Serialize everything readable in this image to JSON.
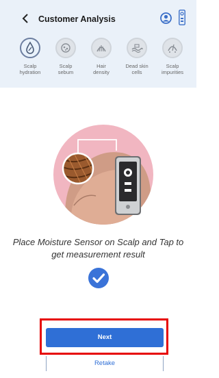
{
  "header": {
    "title": "Customer Analysis"
  },
  "tabs": [
    {
      "line1": "Scalp",
      "line2": "hydration",
      "active": true,
      "icon": "hydration-icon"
    },
    {
      "line1": "Scalp",
      "line2": "sebum",
      "active": false,
      "icon": "sebum-icon"
    },
    {
      "line1": "Hair",
      "line2": "density",
      "active": false,
      "icon": "hair-density-icon"
    },
    {
      "line1": "Dead skin",
      "line2": "cells",
      "active": false,
      "icon": "dead-skin-icon"
    },
    {
      "line1": "Scalp",
      "line2": "impurities",
      "active": false,
      "icon": "impurities-icon"
    }
  ],
  "instruction": {
    "line1": "Place Moisture Sensor on Scalp and Tap to",
    "line2": "get measurement result"
  },
  "buttons": {
    "next": "Next",
    "retake": "Retake"
  },
  "colors": {
    "accent": "#2f6fd6",
    "highlight": "#e60000",
    "header_bg": "#eaf1f9"
  }
}
